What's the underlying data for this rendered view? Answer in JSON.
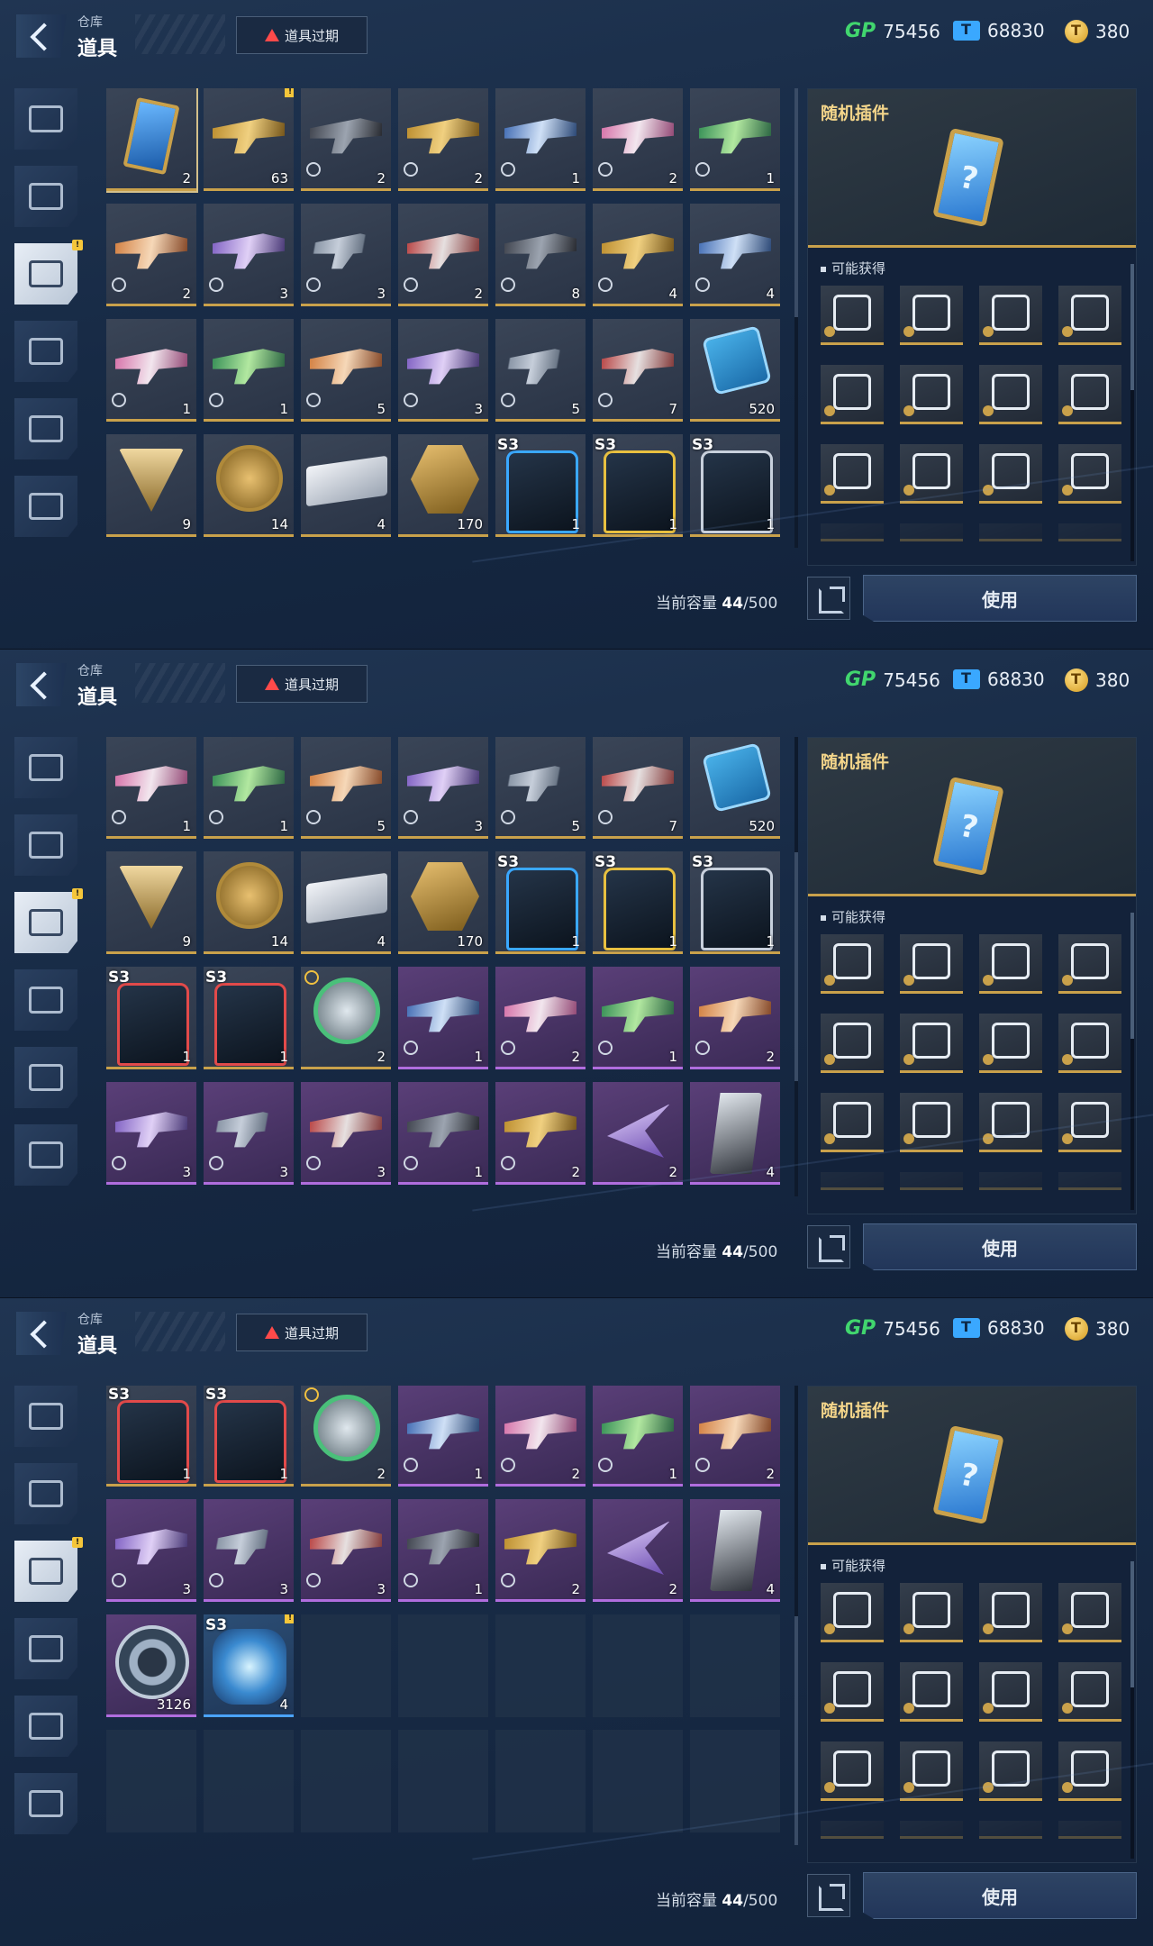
{
  "header": {
    "breadcrumb_parent": "仓库",
    "title": "道具",
    "expiry_button": "道具过期",
    "currencies": [
      {
        "name": "GP",
        "value": "75456"
      },
      {
        "name": "ticket",
        "value": "68830"
      },
      {
        "name": "coin",
        "value": "380"
      }
    ]
  },
  "sidebar": {
    "tabs": [
      "weapon-icon",
      "armor-icon",
      "item-icon",
      "vehicle-icon",
      "emote-icon",
      "badge-icon"
    ],
    "active_index": 2
  },
  "items": [
    {
      "icon": "random-plugin-card",
      "count": "2",
      "selected": true
    },
    {
      "icon": "mystery-weapon-crate",
      "count": "63",
      "new": true
    },
    {
      "icon": "gun-icon",
      "count": "2",
      "timed": true
    },
    {
      "icon": "gun-icon",
      "count": "2",
      "timed": true
    },
    {
      "icon": "gun-icon",
      "count": "1",
      "timed": true
    },
    {
      "icon": "gun-icon",
      "count": "2",
      "timed": true
    },
    {
      "icon": "gun-icon",
      "count": "1",
      "timed": true
    },
    {
      "icon": "gun-icon",
      "count": "2",
      "timed": true
    },
    {
      "icon": "gun-icon",
      "count": "3",
      "timed": true
    },
    {
      "icon": "gun-icon",
      "count": "3",
      "timed": true
    },
    {
      "icon": "gun-icon",
      "count": "2",
      "timed": true
    },
    {
      "icon": "gun-icon",
      "count": "8",
      "timed": true
    },
    {
      "icon": "gun-icon",
      "count": "4",
      "timed": true
    },
    {
      "icon": "gun-icon",
      "count": "4",
      "timed": true
    },
    {
      "icon": "gun-icon",
      "count": "1",
      "timed": true
    },
    {
      "icon": "gun-icon",
      "count": "1",
      "timed": true
    },
    {
      "icon": "gun-icon",
      "count": "5",
      "timed": true
    },
    {
      "icon": "gun-icon",
      "count": "3",
      "timed": true
    },
    {
      "icon": "gun-icon",
      "count": "5",
      "timed": true
    },
    {
      "icon": "gun-icon",
      "count": "7",
      "timed": true
    },
    {
      "icon": "chip-icon",
      "count": "520"
    },
    {
      "icon": "triangle-emblem",
      "count": "9"
    },
    {
      "icon": "gold-medal",
      "count": "14"
    },
    {
      "icon": "supply-box",
      "count": "4"
    },
    {
      "icon": "hex-badge",
      "count": "170"
    },
    {
      "icon": "backpack-icon",
      "count": "1",
      "season": "S3"
    },
    {
      "icon": "backpack-icon",
      "count": "1",
      "season": "S3"
    },
    {
      "icon": "backpack-icon",
      "count": "1",
      "season": "S3"
    },
    {
      "icon": "backpack-icon",
      "count": "1",
      "season": "S3"
    },
    {
      "icon": "backpack-icon",
      "count": "1",
      "season": "S3"
    },
    {
      "icon": "emblem-icon",
      "count": "2",
      "timed_gold": true
    },
    {
      "icon": "gun-icon",
      "count": "1",
      "timed": true,
      "rarity": "purple"
    },
    {
      "icon": "gun-icon",
      "count": "2",
      "timed": true,
      "rarity": "purple"
    },
    {
      "icon": "gun-icon",
      "count": "1",
      "timed": true,
      "rarity": "purple"
    },
    {
      "icon": "gun-icon",
      "count": "2",
      "timed": true,
      "rarity": "purple"
    },
    {
      "icon": "gun-icon",
      "count": "3",
      "timed": true,
      "rarity": "purple"
    },
    {
      "icon": "gun-icon",
      "count": "3",
      "timed": true,
      "rarity": "purple"
    },
    {
      "icon": "gun-icon",
      "count": "3",
      "timed": true,
      "rarity": "purple"
    },
    {
      "icon": "gun-icon",
      "count": "1",
      "timed": true,
      "rarity": "purple"
    },
    {
      "icon": "gun-icon",
      "count": "2",
      "timed": true,
      "rarity": "purple"
    },
    {
      "icon": "wing-icon",
      "count": "2",
      "rarity": "purple"
    },
    {
      "icon": "shard-card",
      "count": "4",
      "rarity": "purple"
    },
    {
      "icon": "ring-token",
      "count": "3126",
      "rarity": "purple"
    },
    {
      "icon": "energy-pod",
      "count": "4",
      "season": "S3",
      "new": true,
      "rarity": "blue"
    }
  ],
  "capacity": {
    "label": "当前容量",
    "current": "44",
    "max": "/500"
  },
  "detail": {
    "title": "随机插件",
    "obtain_label": "可能获得",
    "rewards": [
      "plugin-1-icon",
      "plugin-2-icon",
      "plugin-3-icon",
      "plugin-4-icon",
      "plugin-5-icon",
      "plugin-6-icon",
      "plugin-7-icon",
      "plugin-8-icon",
      "plugin-9-icon",
      "plugin-10-icon",
      "plugin-11-icon",
      "plugin-12-icon"
    ]
  },
  "use_button": "使用",
  "scroll_states": [
    0,
    0.5,
    1
  ]
}
